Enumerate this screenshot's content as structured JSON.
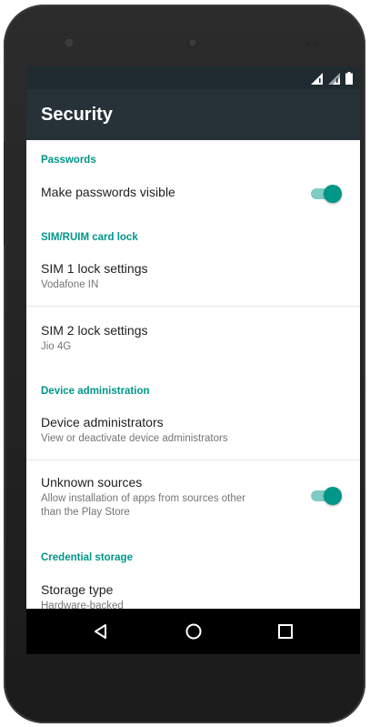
{
  "colors": {
    "accent": "#009688",
    "app_bar": "#263238",
    "status_bar": "#1f2b30",
    "toggle_track": "#80cbc4"
  },
  "status_bar": {
    "icons": [
      "signal-icon",
      "signal-icon-2",
      "battery-icon"
    ]
  },
  "app_bar": {
    "title": "Security"
  },
  "sections": {
    "passwords": {
      "header": "Passwords",
      "make_visible": {
        "title": "Make passwords visible",
        "toggle_on": true
      }
    },
    "sim_lock": {
      "header": "SIM/RUIM card lock",
      "sim1": {
        "title": "SIM 1 lock settings",
        "subtitle": "Vodafone IN"
      },
      "sim2": {
        "title": "SIM 2 lock settings",
        "subtitle": "Jio 4G"
      }
    },
    "device_admin": {
      "header": "Device administration",
      "administrators": {
        "title": "Device administrators",
        "subtitle": "View or deactivate device administrators"
      },
      "unknown_sources": {
        "title": "Unknown sources",
        "subtitle_line1": "Allow installation of apps from sources other",
        "subtitle_line2": "than the Play Store",
        "toggle_on": true
      }
    },
    "credentials": {
      "header": "Credential storage",
      "storage_type": {
        "title": "Storage type",
        "subtitle": "Hardware-backed"
      }
    }
  },
  "nav_bar": {
    "icons": [
      "back-icon",
      "home-icon",
      "recents-icon"
    ]
  }
}
